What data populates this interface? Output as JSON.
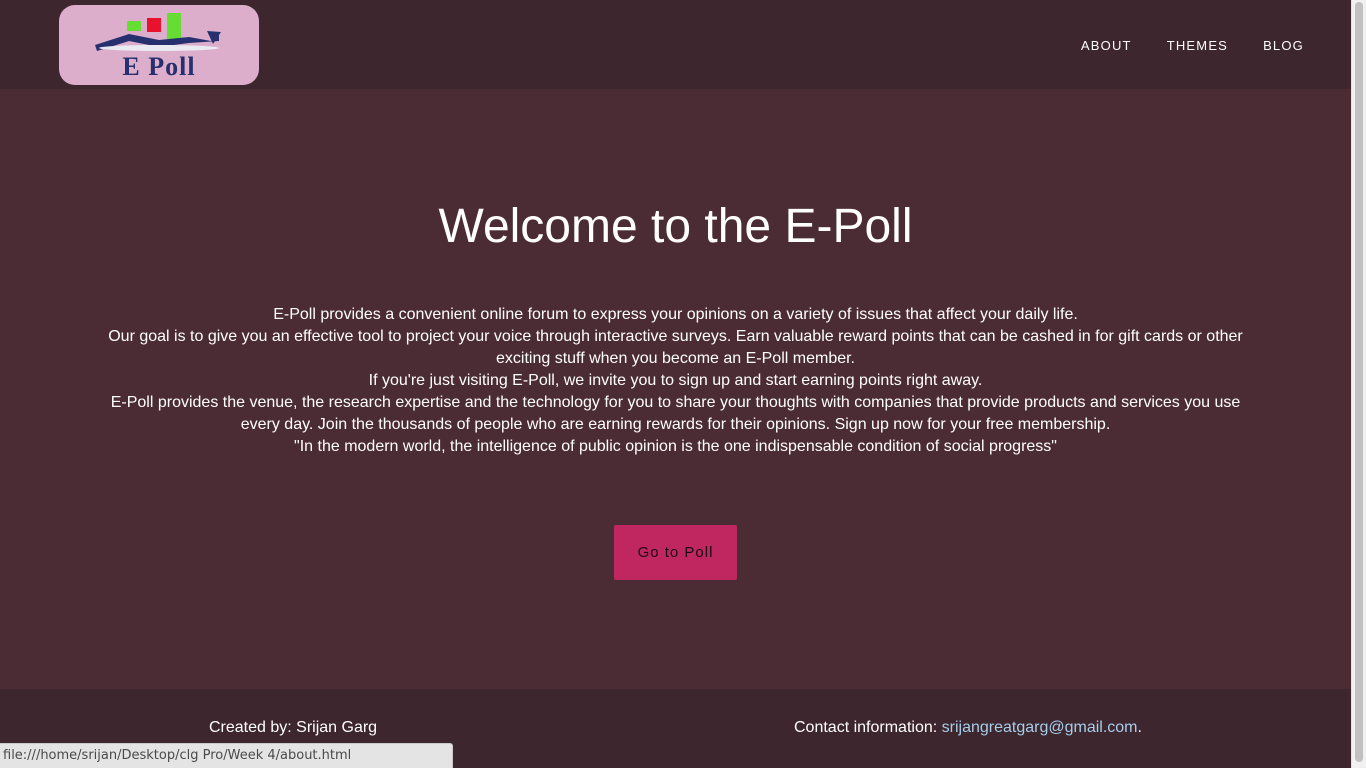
{
  "header": {
    "logo": {
      "text": "E Poll",
      "bar_colors": [
        "#66dd33",
        "#e8122e",
        "#66dd33"
      ],
      "arrow_color": "#27306e"
    },
    "nav": [
      {
        "label": "ABOUT"
      },
      {
        "label": "THEMES"
      },
      {
        "label": "BLOG"
      }
    ]
  },
  "hero": {
    "title": "Welcome to the E-Poll",
    "paragraphs": [
      "E-Poll provides a convenient online forum to express your opinions on a variety of issues that affect your daily life.",
      "Our goal is to give you an effective tool to project your voice through interactive surveys. Earn valuable reward points that can be cashed in for gift cards or other exciting stuff when you become an E-Poll member.",
      "If you're just visiting E-Poll, we invite you to sign up and start earning points right away.",
      "E-Poll provides the venue, the research expertise and the technology for you to share your thoughts with companies that provide products and services you use every day. Join the thousands of people who are earning rewards for their opinions. Sign up now for your free membership.",
      "\"In the modern world, the intelligence of public opinion is the one indispensable condition of social progress\""
    ],
    "cta_label": "Go to Poll"
  },
  "footer": {
    "created_by": "Created by: Srijan Garg",
    "contact_prefix": "Contact information: ",
    "contact_email": "srijangreatgarg@gmail.com",
    "contact_suffix": "."
  },
  "status_bar": {
    "url": "file:///home/srijan/Desktop/clg Pro/Week 4/about.html"
  },
  "colors": {
    "header_bg": "#3d262d",
    "hero_bg": "#4b2c35",
    "button_bg": "#c02660",
    "link": "#a6cdea",
    "logo_bg": "#dcaecb"
  }
}
